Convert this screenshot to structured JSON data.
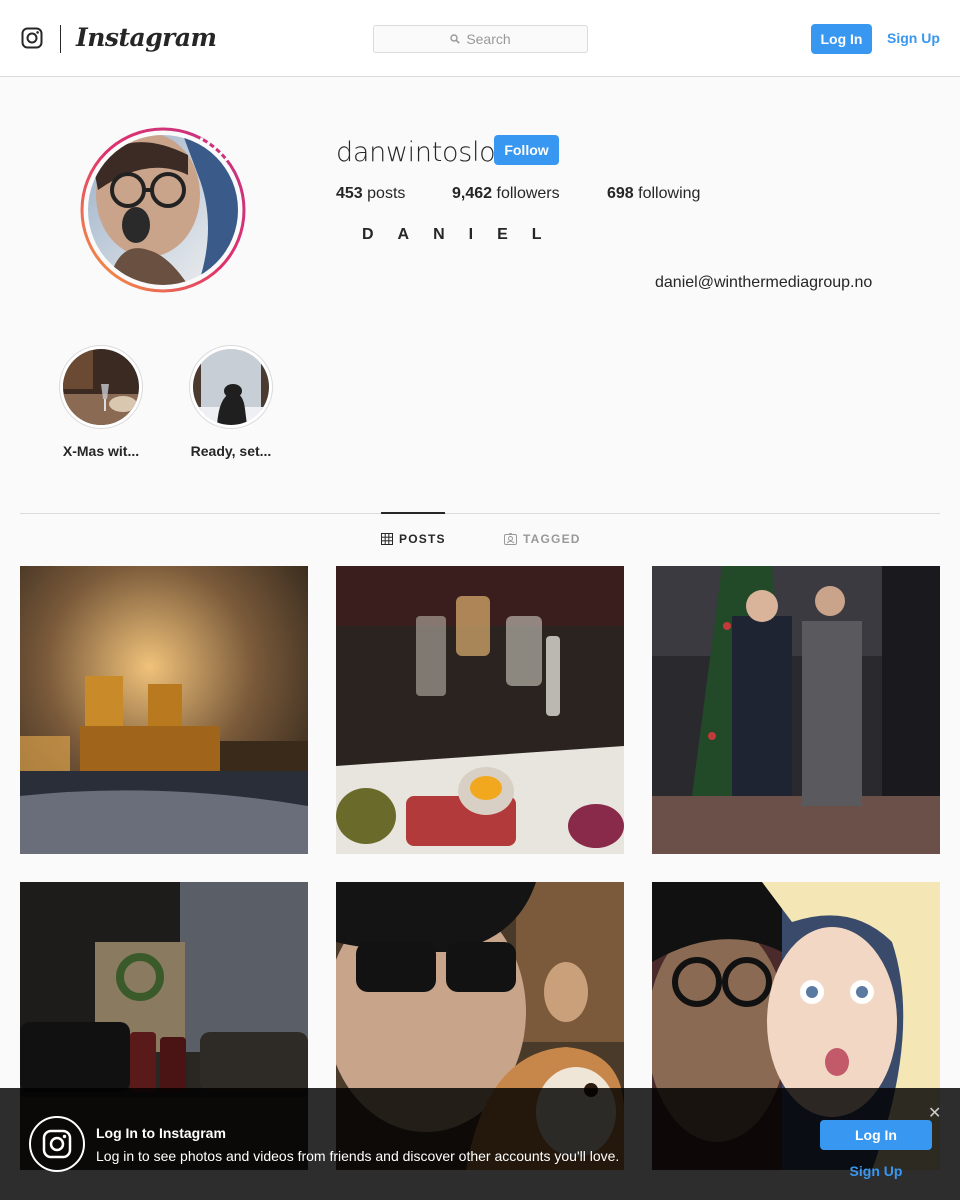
{
  "nav": {
    "logo_icon": "instagram-camera-icon",
    "wordmark": "Instagram",
    "search_placeholder": "Search",
    "search_icon": "search-icon",
    "login_label": "Log In",
    "signup_label": "Sign Up"
  },
  "profile": {
    "username": "danwintoslo",
    "follow_label": "Follow",
    "stats": {
      "posts_count": "453",
      "posts_label": "posts",
      "followers_count": "9,462",
      "followers_label": "followers",
      "following_count": "698",
      "following_label": "following"
    },
    "full_name": "DANIEL",
    "bio_email": "daniel@winthermediagroup.no"
  },
  "highlights": [
    {
      "label": "X-Mas wit..."
    },
    {
      "label": "Ready, set..."
    }
  ],
  "tabs": {
    "posts_label": "POSTS",
    "tagged_label": "TAGGED"
  },
  "posts": [
    {
      "kind": "city-hall-night"
    },
    {
      "kind": "restaurant-dinner"
    },
    {
      "kind": "christmas-tree-suits"
    },
    {
      "kind": "lounge-fireplace"
    },
    {
      "kind": "selfie-dog"
    },
    {
      "kind": "selfie-couple"
    }
  ],
  "banner": {
    "title": "Log In to Instagram",
    "text": "Log in to see photos and videos from friends and discover other accounts you'll love.",
    "login_label": "Log In",
    "signup_label": "Sign Up",
    "close_icon": "close-icon"
  },
  "colors": {
    "accent": "#3897f0",
    "text": "#262626",
    "muted": "#999999",
    "border": "#dbdbdb",
    "background": "#fafafa"
  }
}
